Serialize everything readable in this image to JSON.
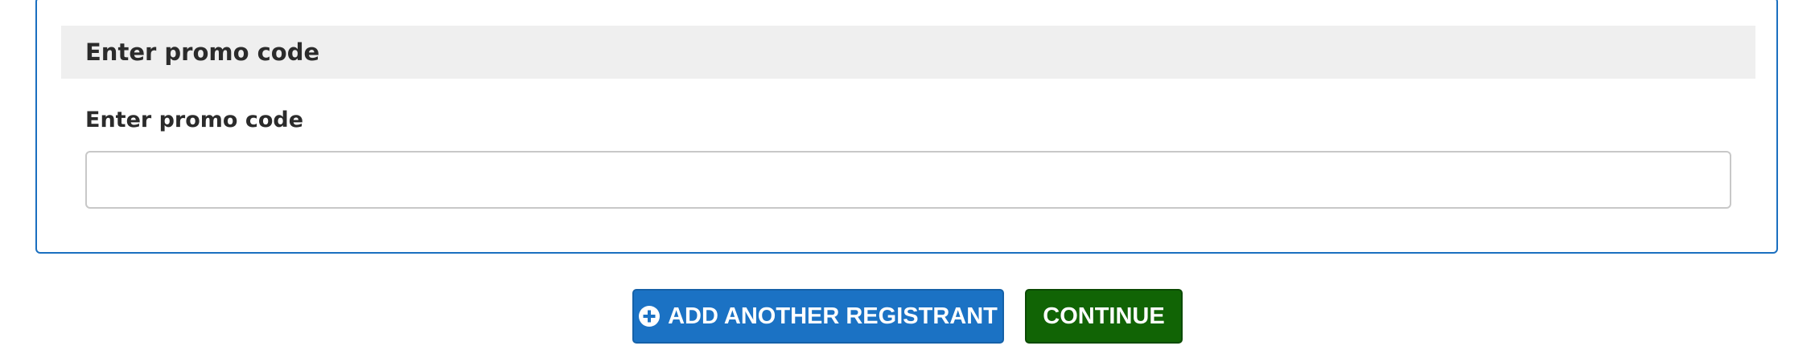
{
  "promo_section": {
    "header_title": "Enter promo code",
    "field_label": "Enter promo code",
    "field_value": "",
    "field_placeholder": ""
  },
  "actions": {
    "add_registrant_label": "ADD ANOTHER REGISTRANT",
    "add_registrant_icon": "plus-circle-icon",
    "continue_label": "CONTINUE"
  },
  "colors": {
    "panel_border": "#1a6fc0",
    "header_background": "#efefef",
    "add_button": "#1b72c4",
    "continue_button": "#116405"
  }
}
